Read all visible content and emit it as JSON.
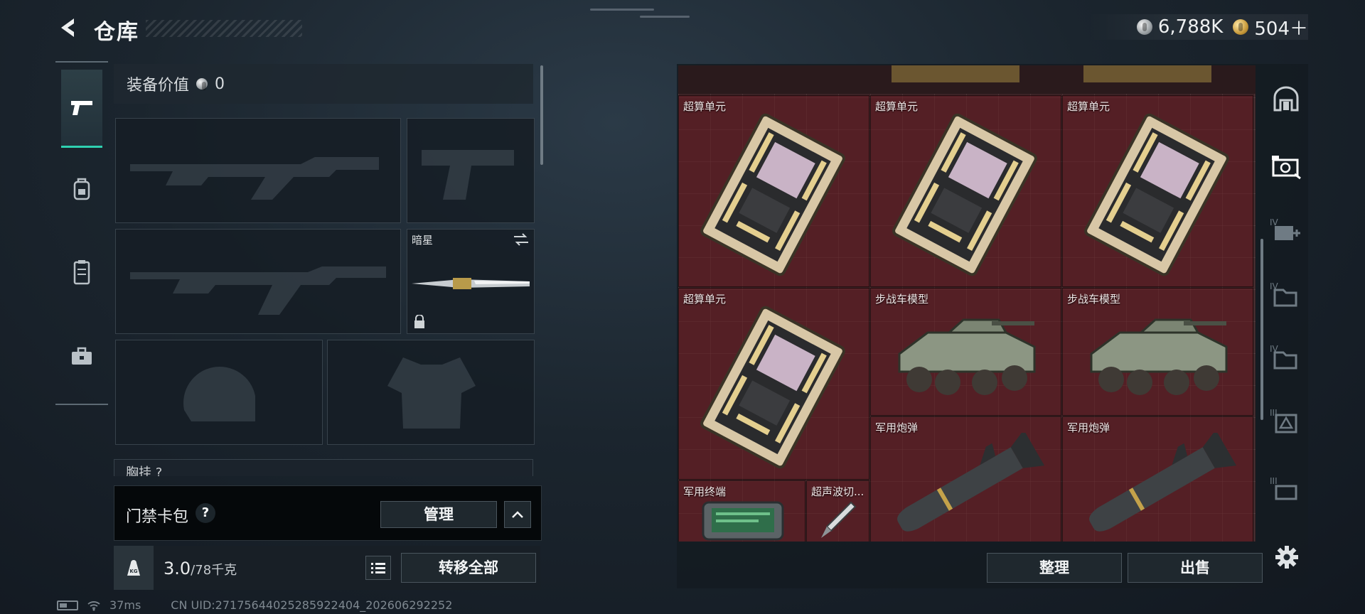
{
  "header": {
    "title": "仓库",
    "currency": [
      {
        "icon": "silver-coin-icon",
        "value": "6,788K"
      },
      {
        "icon": "gold-coin-icon",
        "value": "504＋"
      }
    ]
  },
  "sidebar": {
    "tabs": [
      {
        "icon": "pistol-icon",
        "active": true
      },
      {
        "icon": "backpack-icon",
        "active": false
      },
      {
        "icon": "vest-icon",
        "active": false
      },
      {
        "icon": "briefcase-icon",
        "active": false
      }
    ]
  },
  "loadout": {
    "value_label": "装备价值",
    "value": "0",
    "melee_name": "暗星",
    "chest_label": "胸挂 ?"
  },
  "access_card": {
    "label": "门禁卡包",
    "help": "?",
    "manage": "管理"
  },
  "weight": {
    "current": "3.0",
    "capacity": "/78千克",
    "transfer_all": "转移全部"
  },
  "status_bar": {
    "ping": "37ms",
    "uid": "CN UID:2717564402528592240​4_202606292252"
  },
  "stash": {
    "items": [
      {
        "name": "超算单元"
      },
      {
        "name": "超算单元"
      },
      {
        "name": "超算单元"
      },
      {
        "name": "超算单元"
      },
      {
        "name": "步战车模型"
      },
      {
        "name": "步战车模型"
      },
      {
        "name": "军用炮弹"
      },
      {
        "name": "军用炮弹"
      },
      {
        "name": "军用终端"
      },
      {
        "name": "超声波切..."
      }
    ],
    "sort": "整理",
    "sell": "出售"
  },
  "right_tabs": {
    "labels": [
      "IV",
      "IV",
      "IV",
      "III",
      "III"
    ]
  },
  "colors": {
    "accent": "#2fd0b0",
    "stash_bg": "#3b2326"
  }
}
